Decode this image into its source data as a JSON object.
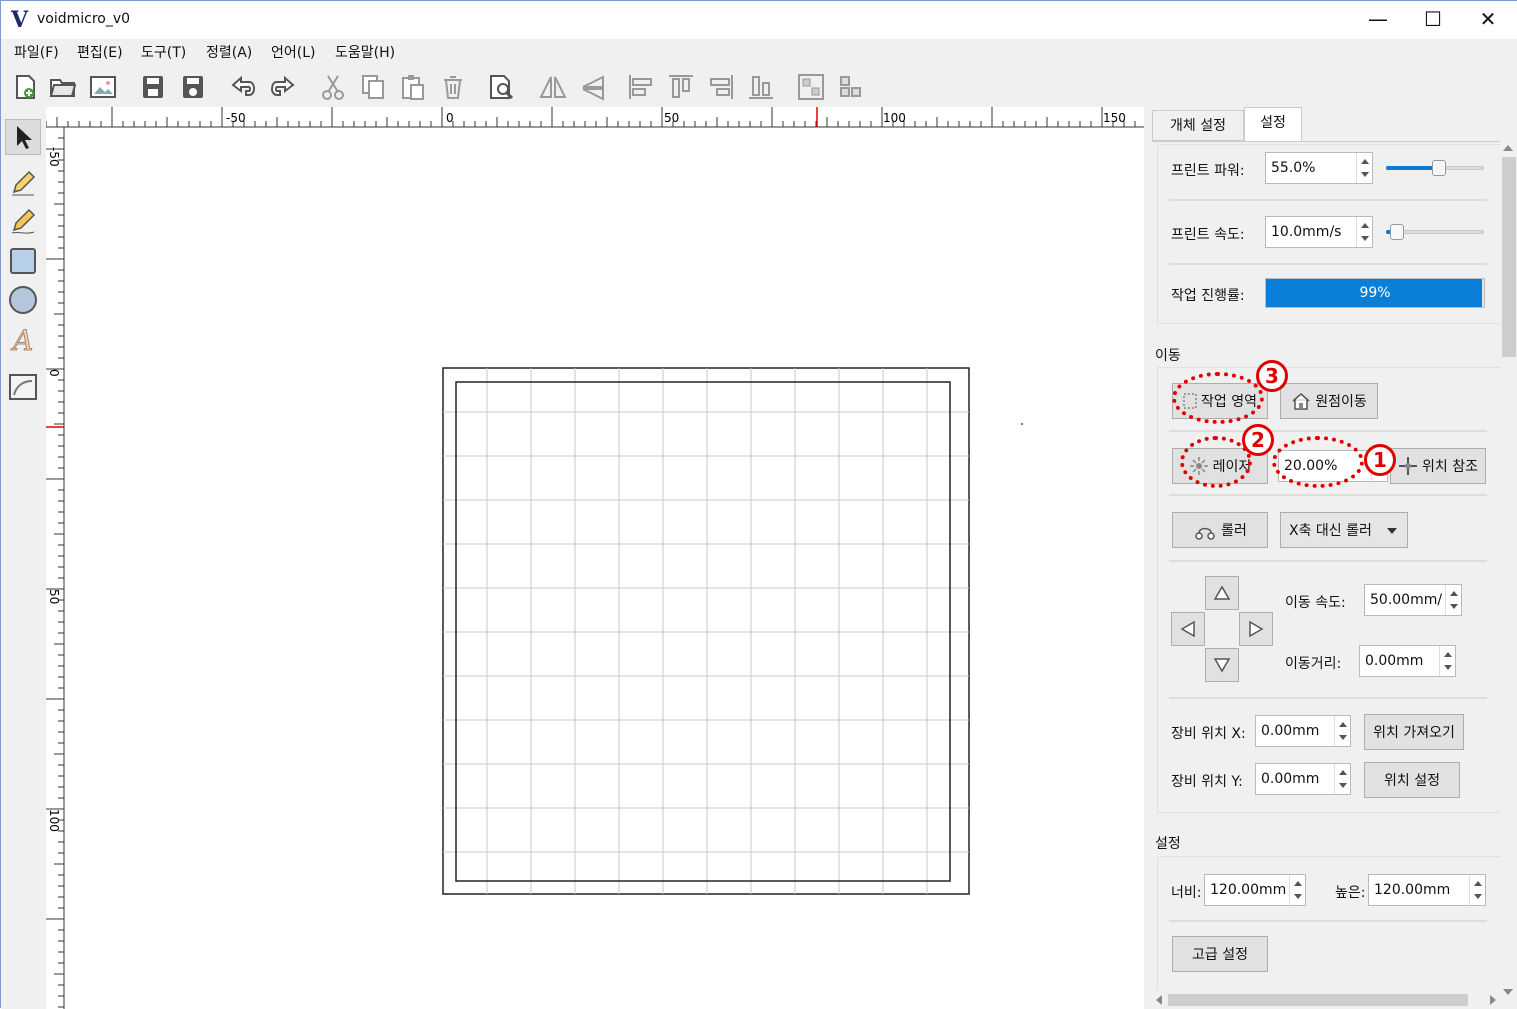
{
  "window": {
    "title": "voidmicro_v0",
    "logo": "V",
    "minimize": "—",
    "maximize": "☐",
    "close": "✕"
  },
  "menu": [
    {
      "label": "파일(F)"
    },
    {
      "label": "편집(E)"
    },
    {
      "label": "도구(T)"
    },
    {
      "label": "정렬(A)"
    },
    {
      "label": "언어(L)"
    },
    {
      "label": "도움말(H)"
    }
  ],
  "toolbar_icons": [
    "new-file-icon",
    "open-folder-icon",
    "import-image-icon",
    "save-icon",
    "save-as-icon",
    "undo-icon",
    "redo-icon",
    "cut-icon",
    "copy-icon",
    "paste-icon",
    "delete-icon",
    "preview-icon",
    "flip-horizontal-icon",
    "flip-vertical-icon",
    "align-left-icon",
    "align-top-icon",
    "align-right-icon",
    "align-bottom-icon",
    "group-icon",
    "ungroup-icon"
  ],
  "left_tools": [
    "select-arrow-icon",
    "pencil-icon",
    "pen-icon",
    "rectangle-icon",
    "circle-icon",
    "text-icon",
    "image-icon"
  ],
  "ruler": {
    "h_labels": [
      "-50",
      "0",
      "50",
      "100",
      "150"
    ],
    "v_labels": [
      "-50",
      "0",
      "50",
      "100"
    ]
  },
  "tabs": [
    {
      "label": "개체 설정"
    },
    {
      "label": "설정"
    }
  ],
  "settings": {
    "print_power_label": "프린트 파워:",
    "print_power_value": "55.0%",
    "print_power_slider": 0.55,
    "print_speed_label": "프린트 속도:",
    "print_speed_value": "10.0mm/s",
    "print_speed_slider": 0.05,
    "progress_label": "작업 진행률:",
    "progress_value": "99%",
    "progress_fraction": 0.99,
    "move_section": "이동",
    "work_area_button": "작업 영역",
    "home_button": "원점이동",
    "laser_button": "레이저",
    "laser_power_value": "20.00%",
    "position_ref_button": "위치 참조",
    "roller_button": "롤러",
    "roller_select": "X축 대신 롤러",
    "move_speed_label": "이동 속도:",
    "move_speed_value": "50.00mm/",
    "move_distance_label": "이동거리:",
    "move_distance_value": "0.00mm",
    "device_x_label": "장비 위치 X:",
    "device_x_value": "0.00mm",
    "get_position_button": "위치 가져오기",
    "device_y_label": "장비 위치 Y:",
    "device_y_value": "0.00mm",
    "set_position_button": "위치 설정",
    "settings_section": "설정",
    "width_label": "너비:",
    "width_value": "120.00mm",
    "height_label": "높은:",
    "height_value": "120.00mm",
    "advanced_button": "고급 설정"
  },
  "annotations": {
    "one": "1",
    "two": "2",
    "three": "3"
  },
  "colors": {
    "accent": "#0b7fd7",
    "annotation": "#e00000"
  }
}
